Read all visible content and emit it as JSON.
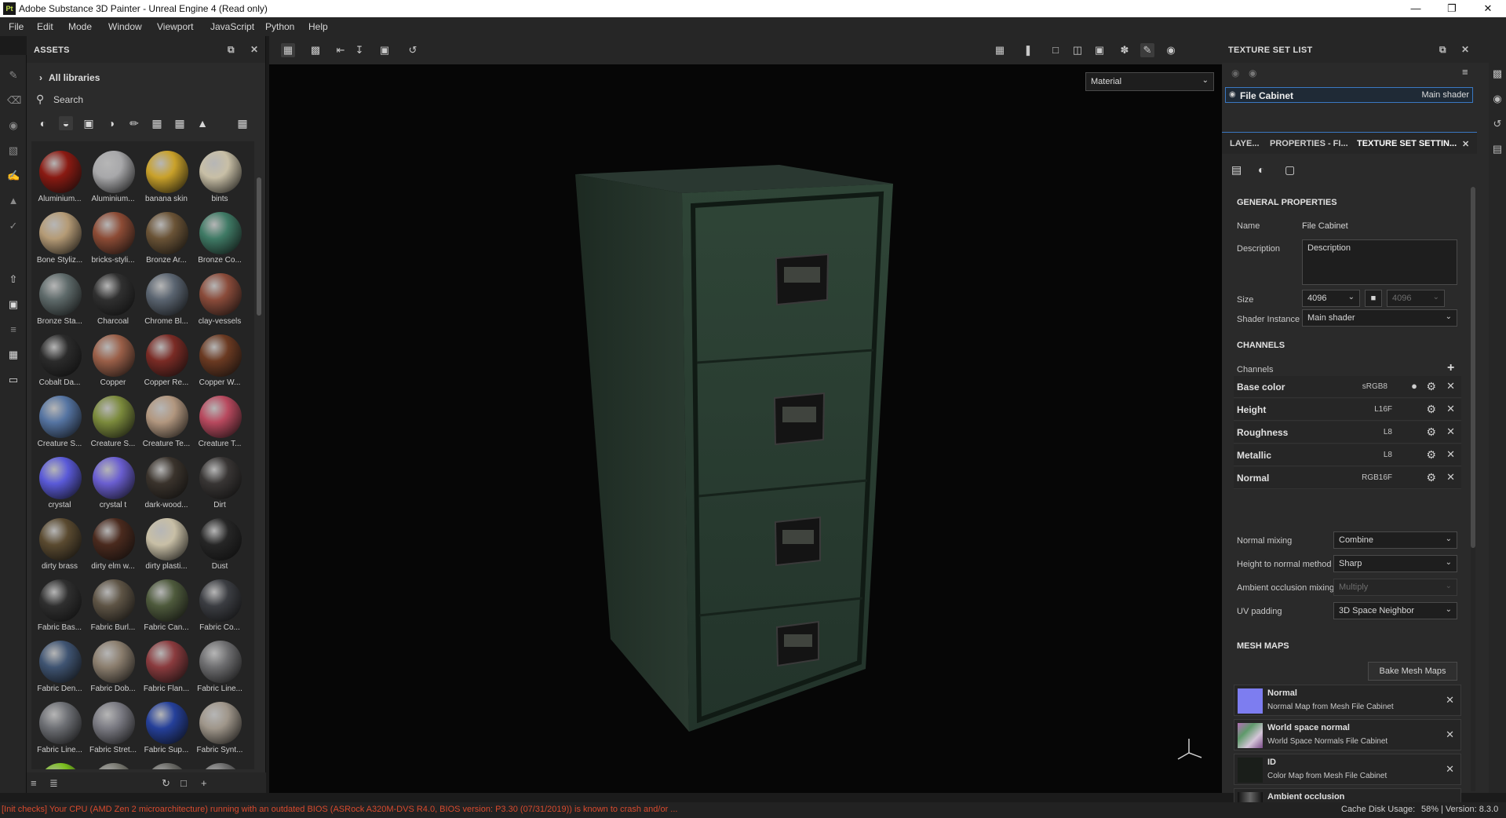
{
  "window": {
    "title": "Adobe Substance 3D Painter - Unreal Engine 4 (Read only)",
    "app_icon": "Pt"
  },
  "menu": [
    "File",
    "Edit",
    "Mode",
    "Window",
    "Viewport",
    "JavaScript",
    "Python",
    "Help"
  ],
  "assets": {
    "title": "ASSETS",
    "library": "All libraries",
    "search_placeholder": "Search",
    "items": [
      {
        "label": "Aluminium...",
        "color": "#8a1a12"
      },
      {
        "label": "Aluminium...",
        "color": "#a8a8aa"
      },
      {
        "label": "banana skin",
        "color": "#c9a12a"
      },
      {
        "label": "bints",
        "color": "#c8bfa6"
      },
      {
        "label": "Bone Styliz...",
        "color": "#b59b76"
      },
      {
        "label": "bricks-styli...",
        "color": "#8c4b35"
      },
      {
        "label": "Bronze Ar...",
        "color": "#6a5336"
      },
      {
        "label": "Bronze Co...",
        "color": "#3f7a65"
      },
      {
        "label": "Bronze Sta...",
        "color": "#5e6a6a"
      },
      {
        "label": "Charcoal",
        "color": "#303030"
      },
      {
        "label": "Chrome Bl...",
        "color": "#5a6470"
      },
      {
        "label": "clay-vessels",
        "color": "#8a4b3a"
      },
      {
        "label": "Cobalt Da...",
        "color": "#2b2b2b"
      },
      {
        "label": "Copper",
        "color": "#9a5f48"
      },
      {
        "label": "Copper Re...",
        "color": "#7a2b25"
      },
      {
        "label": "Copper W...",
        "color": "#6b3a22"
      },
      {
        "label": "Creature S...",
        "color": "#5574a2"
      },
      {
        "label": "Creature S...",
        "color": "#7b8a3c"
      },
      {
        "label": "Creature Te...",
        "color": "#b2977f"
      },
      {
        "label": "Creature T...",
        "color": "#b8495e"
      },
      {
        "label": "crystal",
        "color": "#5a5ad8"
      },
      {
        "label": "crystal t",
        "color": "#6a5ed0"
      },
      {
        "label": "dark-wood...",
        "color": "#3a332c"
      },
      {
        "label": "Dirt",
        "color": "#383534"
      },
      {
        "label": "dirty brass",
        "color": "#5a4a30"
      },
      {
        "label": "dirty elm w...",
        "color": "#4a2a1e"
      },
      {
        "label": "dirty plasti...",
        "color": "#c8bfa6"
      },
      {
        "label": "Dust",
        "color": "#262626"
      },
      {
        "label": "Fabric Bas...",
        "color": "#2f2f2f"
      },
      {
        "label": "Fabric Burl...",
        "color": "#5e5445"
      },
      {
        "label": "Fabric Can...",
        "color": "#4e5a3c"
      },
      {
        "label": "Fabric Co...",
        "color": "#3b3d42"
      },
      {
        "label": "Fabric Den...",
        "color": "#3f5472"
      },
      {
        "label": "Fabric Dob...",
        "color": "#8b7e6e"
      },
      {
        "label": "Fabric Flan...",
        "color": "#8a3b3e"
      },
      {
        "label": "Fabric Line...",
        "color": "#6e6e70"
      },
      {
        "label": "Fabric Line...",
        "color": "#6d6f74"
      },
      {
        "label": "Fabric Stret...",
        "color": "#7a7a82"
      },
      {
        "label": "Fabric Sup...",
        "color": "#25409a"
      },
      {
        "label": "Fabric Synt...",
        "color": "#9f968a"
      },
      {
        "label": "",
        "color": "#7bbf1e"
      },
      {
        "label": "",
        "color": "#7a7a72"
      },
      {
        "label": "",
        "color": "#6a6a66"
      },
      {
        "label": "",
        "color": "#6e6e6e"
      }
    ]
  },
  "viewport": {
    "material_mode": "Material"
  },
  "texture_set_list": {
    "title": "TEXTURE SET LIST",
    "set_name": "File Cabinet",
    "shader": "Main shader"
  },
  "tabs": [
    "LAYE...",
    "PROPERTIES - FI...",
    "TEXTURE SET SETTIN..."
  ],
  "general": {
    "section": "GENERAL PROPERTIES",
    "name_label": "Name",
    "name_value": "File Cabinet",
    "desc_label": "Description",
    "desc_placeholder": "Description",
    "size_label": "Size",
    "size_value": "4096",
    "size_value2": "4096",
    "shader_label": "Shader Instance",
    "shader_value": "Main shader"
  },
  "channels": {
    "section": "CHANNELS",
    "label": "Channels",
    "items": [
      {
        "name": "Base color",
        "format": "sRGB8"
      },
      {
        "name": "Height",
        "format": "L16F"
      },
      {
        "name": "Roughness",
        "format": "L8"
      },
      {
        "name": "Metallic",
        "format": "L8"
      },
      {
        "name": "Normal",
        "format": "RGB16F"
      }
    ]
  },
  "mixing": {
    "normal_label": "Normal mixing",
    "normal_value": "Combine",
    "h2n_label": "Height to normal method",
    "h2n_value": "Sharp",
    "ao_label": "Ambient occlusion mixing",
    "ao_value": "Multiply",
    "uv_label": "UV padding",
    "uv_value": "3D Space Neighbor"
  },
  "mesh_maps": {
    "section": "MESH MAPS",
    "bake_button": "Bake Mesh Maps",
    "items": [
      {
        "name": "Normal",
        "desc": "Normal Map from Mesh File Cabinet",
        "color": "#7d7df0"
      },
      {
        "name": "World space normal",
        "desc": "World Space Normals File Cabinet",
        "color": "#8a6a8e"
      },
      {
        "name": "ID",
        "desc": "Color Map from Mesh File Cabinet",
        "color": "#1a1e1a"
      },
      {
        "name": "Ambient occlusion",
        "desc": "",
        "color": "#333"
      }
    ]
  },
  "status": {
    "error": "[Init checks] Your CPU (AMD Zen 2 microarchitecture) running with an outdated BIOS (ASRock A320M-DVS R4.0, BIOS version: P3.30 (07/31/2019)) is known to crash and/or ...",
    "cache": "Cache Disk Usage:",
    "cache_value": "58%",
    "version": "| Version: 8.3.0"
  }
}
